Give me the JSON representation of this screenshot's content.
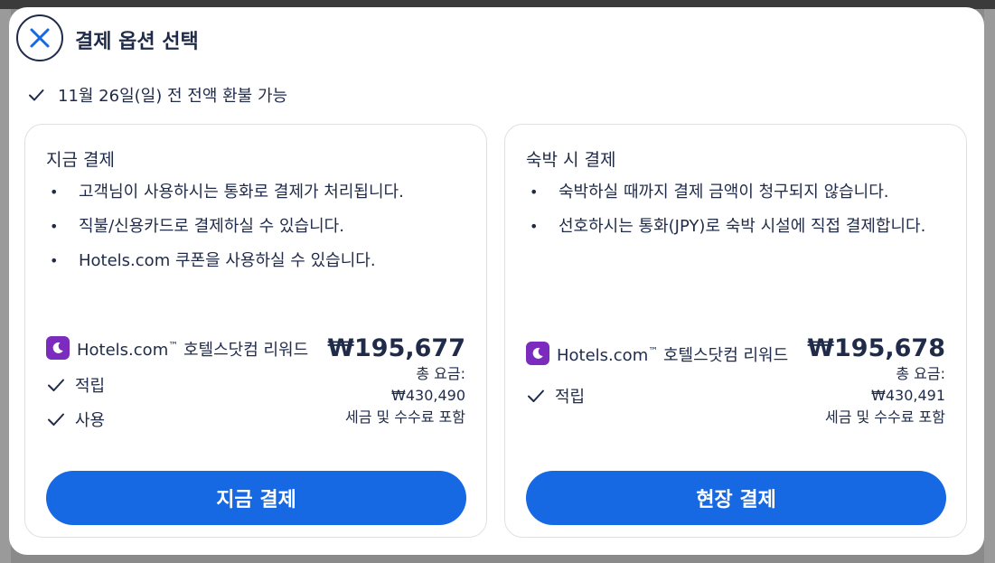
{
  "dialog": {
    "title": "결제 옵션 선택",
    "refund_note": "11월 26일(일) 전 전액 환불 가능"
  },
  "options": [
    {
      "title": "지금 결제",
      "bullets": [
        "고객님이 사용하시는 통화로 결제가 처리됩니다.",
        "직불/신용카드로 결제하실 수 있습니다.",
        "Hotels.com 쿠폰을 사용하실 수 있습니다."
      ],
      "rewards_brand": "Hotels.com",
      "rewards_tm": "™",
      "rewards_suffix": "호텔스닷컴 리워드",
      "perks": [
        "적립",
        "사용"
      ],
      "price": "₩195,677",
      "total_label": "총 요금:",
      "total_value": "₩430,490",
      "tax_note": "세금 및 수수료 포함",
      "button_label": "지금 결제"
    },
    {
      "title": "숙박 시 결제",
      "bullets": [
        "숙박하실 때까지 결제 금액이 청구되지 않습니다.",
        "선호하시는 통화(JPY)로 숙박 시설에 직접 결제합니다."
      ],
      "rewards_brand": "Hotels.com",
      "rewards_tm": "™",
      "rewards_suffix": "호텔스닷컴 리워드",
      "perks": [
        "적립"
      ],
      "price": "₩195,678",
      "total_label": "총 요금:",
      "total_value": "₩430,491",
      "tax_note": "세금 및 수수료 포함",
      "button_label": "현장 결제"
    }
  ],
  "colors": {
    "primary_button": "#1668e3",
    "text": "#1f2b49",
    "rewards_logo": "#7b2bbd",
    "close_icon": "#1668e3"
  },
  "icons": {
    "close": "close-icon",
    "check": "check-icon",
    "rewards": "moon-icon"
  }
}
